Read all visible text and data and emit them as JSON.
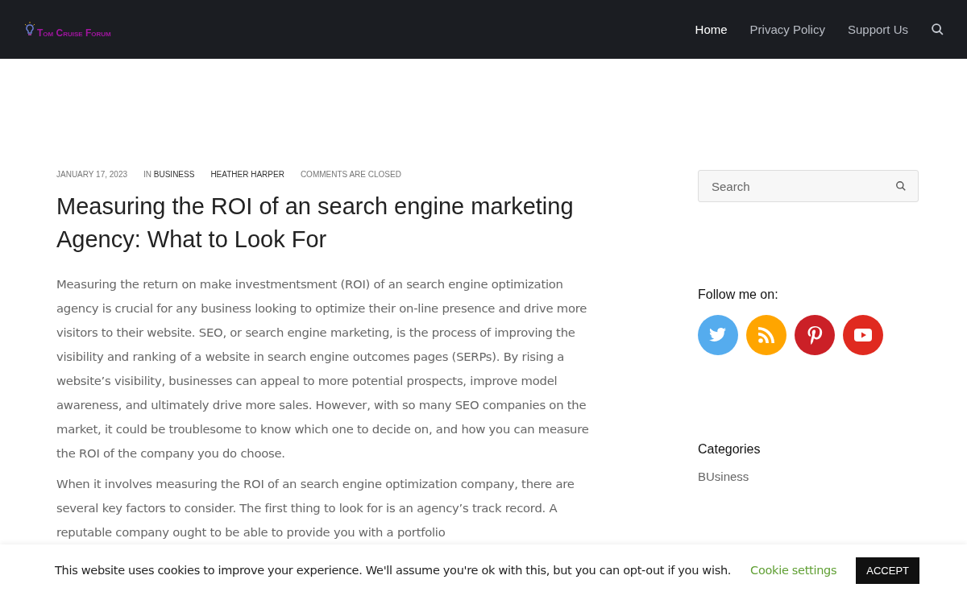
{
  "header": {
    "logo": "Tom Cruise Forum",
    "nav": [
      {
        "label": "Home",
        "selected": true
      },
      {
        "label": "Privacy Policy",
        "selected": false
      },
      {
        "label": "Support Us",
        "selected": false
      }
    ]
  },
  "post": {
    "meta": {
      "date": "JANUARY 17, 2023",
      "category_prefix": "IN",
      "category": "BUSINESS",
      "author": "HEATHER HARPER",
      "comments": "COMMENTS ARE CLOSED"
    },
    "title": "Measuring the ROI of an search engine marketing Agency: What to Look For",
    "paragraphs": [
      "Measuring the return on make investmentsment (ROI) of an search engine optimization agency is crucial for any business looking to optimize their on-line presence and drive more visitors to their website. SEO, or search engine marketing, is the process of improving the visibility and ranking of a website in search engine outcomes pages (SERPs). By rising a website’s visibility, businesses can appeal to more potential prospects, improve model awareness, and ultimately drive more sales. However, with so many SEO companies on the market, it could be troublesome to know which one to decide on, and how you can measure the ROI of the company you do choose.",
      "When it involves measuring the ROI of an search engine optimization company, there are several key factors to consider. The first thing to look for is an agency’s track record. A reputable company ought to be able to provide you with a portfolio"
    ]
  },
  "sidebar": {
    "search": {
      "placeholder": "Search"
    },
    "follow_title": "Follow me on:",
    "social": [
      {
        "kind": "twitter",
        "color": "#55acee"
      },
      {
        "kind": "rss",
        "color": "#ffa500"
      },
      {
        "kind": "pinterest",
        "color": "#cb2027"
      },
      {
        "kind": "youtube",
        "color": "#e02a20"
      }
    ],
    "categories_title": "Categories",
    "categories": [
      "BUsiness"
    ]
  },
  "cookie_bar": {
    "message": "This website uses cookies to improve your experience. We'll assume you're ok with this, but you can opt-out if you wish.",
    "settings": "Cookie settings",
    "accept": "ACCEPT"
  }
}
